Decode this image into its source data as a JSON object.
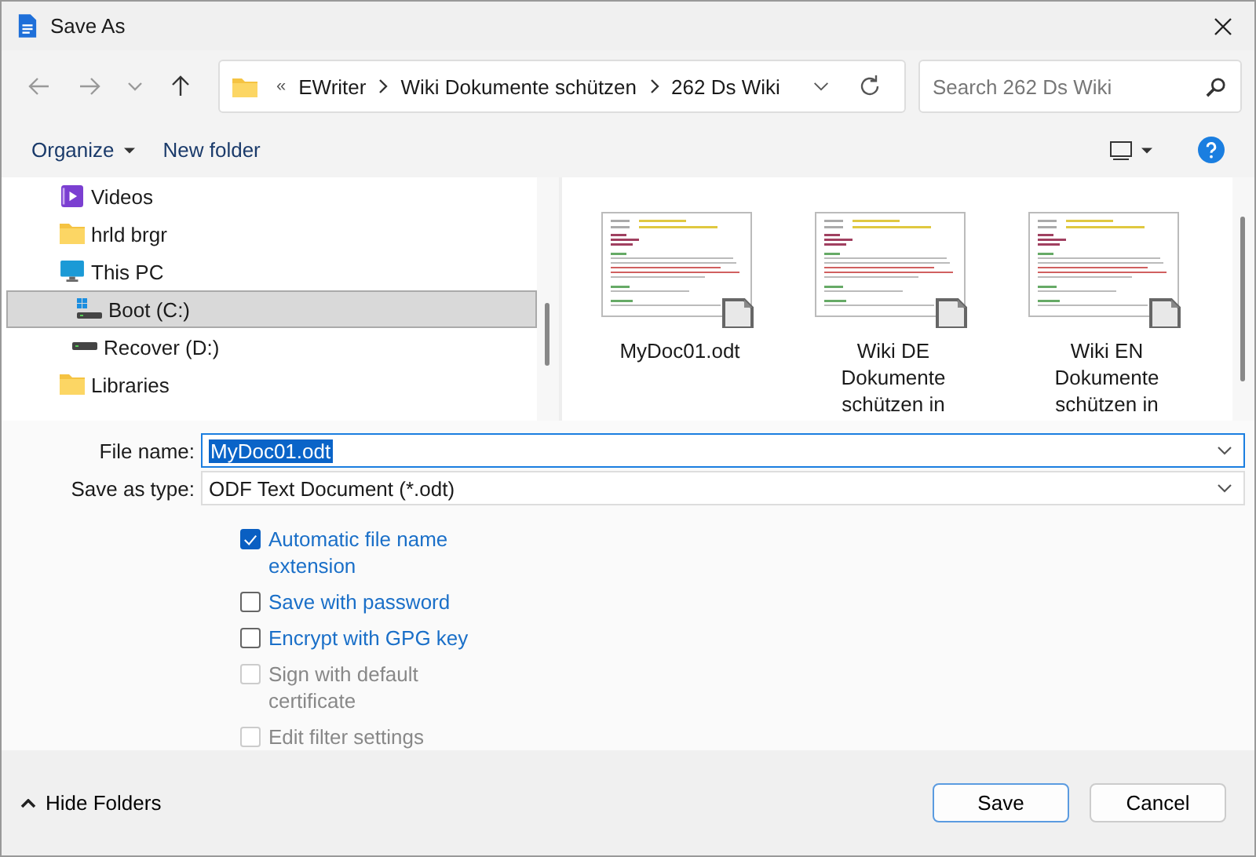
{
  "window": {
    "title": "Save As"
  },
  "address_bar": {
    "overflow": "«",
    "path": [
      "EWriter",
      "Wiki Dokumente schützen",
      "262 Ds Wiki"
    ]
  },
  "search": {
    "placeholder": "Search 262 Ds Wiki"
  },
  "toolbar": {
    "organize": "Organize",
    "new_folder": "New folder"
  },
  "sidebar": {
    "items": [
      {
        "label": "Videos",
        "kind": "video",
        "selected": false
      },
      {
        "label": "hrld brgr",
        "kind": "folder",
        "selected": false
      },
      {
        "label": "This PC",
        "kind": "pc",
        "selected": false,
        "children": [
          {
            "label": "Boot (C:)",
            "kind": "system-drive",
            "selected": true
          },
          {
            "label": "Recover (D:)",
            "kind": "drive",
            "selected": false
          }
        ]
      },
      {
        "label": "Libraries",
        "kind": "folder",
        "selected": false
      }
    ]
  },
  "files": [
    {
      "name": "MyDoc01.odt"
    },
    {
      "name": "Wiki DE Dokumente schützen in"
    },
    {
      "name": "Wiki EN Dokumente schützen in"
    }
  ],
  "form": {
    "file_name_label": "File name:",
    "file_name": "MyDoc01.odt",
    "type_label": "Save as type:",
    "type": "ODF Text Document (*.odt)"
  },
  "options": [
    {
      "label": "Automatic file name extension",
      "checked": true,
      "disabled": false
    },
    {
      "label": "Save with password",
      "checked": false,
      "disabled": false
    },
    {
      "label": "Encrypt with GPG key",
      "checked": false,
      "disabled": false
    },
    {
      "label": "Sign with default certificate",
      "checked": false,
      "disabled": true
    },
    {
      "label": "Edit filter settings",
      "checked": false,
      "disabled": true
    }
  ],
  "footer": {
    "hide_folders": "Hide Folders",
    "buttons": [
      "Save",
      "Cancel"
    ]
  }
}
